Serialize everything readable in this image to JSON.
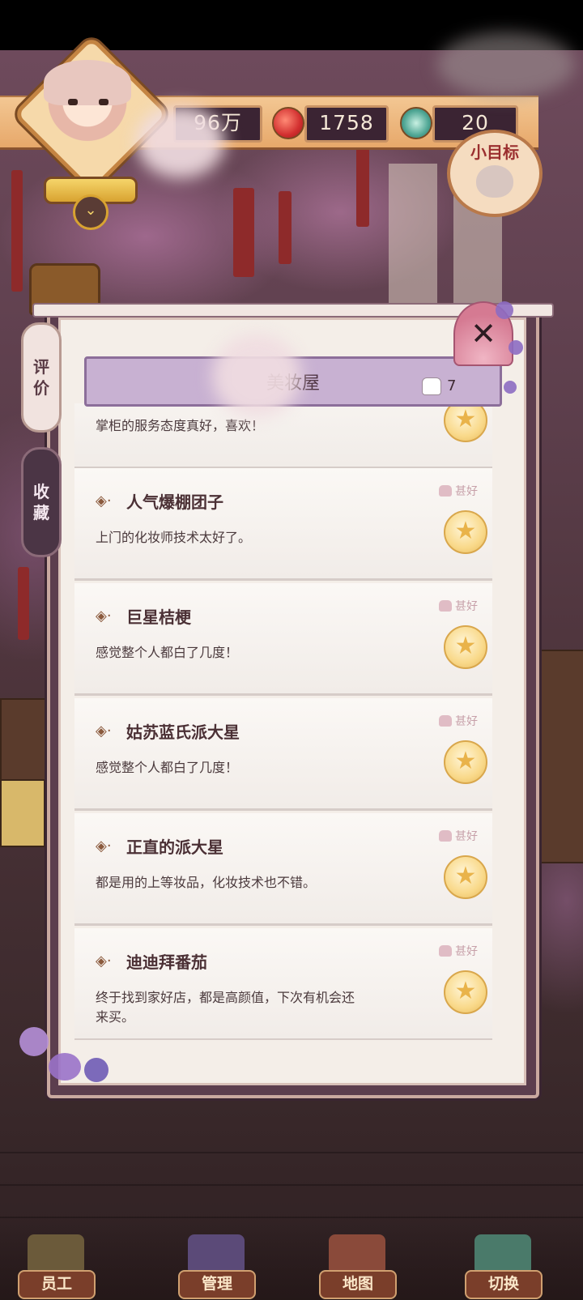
{
  "hud": {
    "coins_value": "96万",
    "apple_value": "1758",
    "gem_value": "20",
    "goal_label": "小目标",
    "expand_icon": "chevron-down-icon"
  },
  "side_tabs": [
    {
      "label_top": "评",
      "label_bottom": "价"
    },
    {
      "label_top": "收",
      "label_bottom": "藏"
    }
  ],
  "dialog": {
    "title": "美妆屋",
    "like_count": "7",
    "close_icon": "close-icon"
  },
  "reviews": [
    {
      "name": "",
      "text": "掌柜的服务态度真好，喜欢！",
      "rating": ""
    },
    {
      "name": "人气爆棚团子",
      "text": "上门的化妆师技术太好了。",
      "rating": "甚好"
    },
    {
      "name": "巨星桔梗",
      "text": "感觉整个人都白了几度！",
      "rating": "甚好"
    },
    {
      "name": "姑苏蓝氏派大星",
      "text": "感觉整个人都白了几度！",
      "rating": "甚好"
    },
    {
      "name": "正直的派大星",
      "text": "都是用的上等妆品，化妆技术也不错。",
      "rating": "甚好"
    },
    {
      "name": "迪迪拜番茄",
      "text": "终于找到家好店，都是高颜值，下次有机会还来买。",
      "rating": "甚好"
    }
  ],
  "nav": [
    {
      "label": "员工",
      "icon": "staff-icon"
    },
    {
      "label": "管理",
      "icon": "manage-icon"
    },
    {
      "label": "地图",
      "icon": "map-icon"
    },
    {
      "label": "切换",
      "icon": "switch-icon"
    }
  ],
  "colors": {
    "accent": "#c89264",
    "panel": "#f4eee8",
    "tab_active": "#4b3545",
    "banner": "#c8b1d2"
  }
}
